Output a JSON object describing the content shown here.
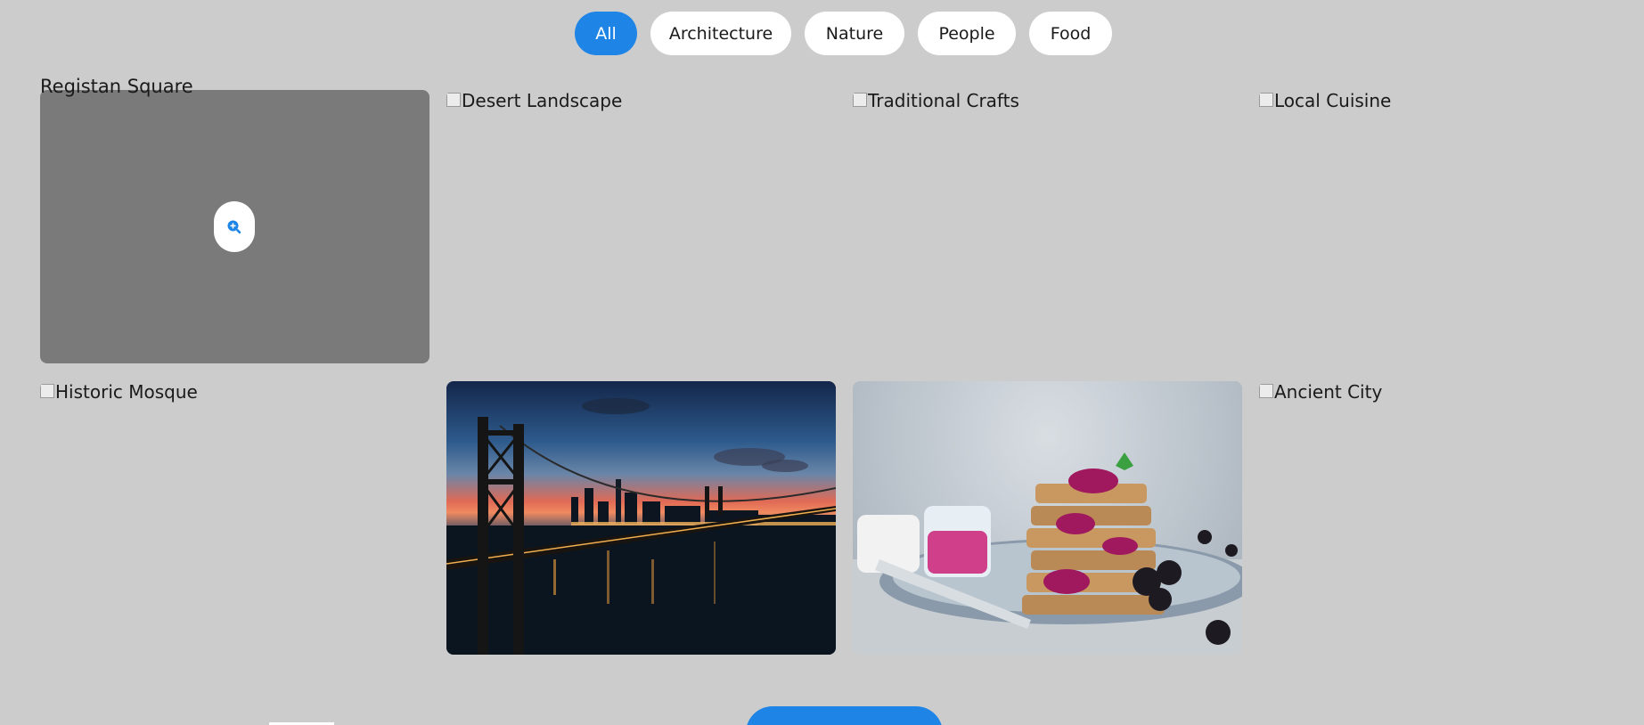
{
  "filters": [
    {
      "label": "All",
      "active": true
    },
    {
      "label": "Architecture",
      "active": false
    },
    {
      "label": "Nature",
      "active": false
    },
    {
      "label": "People",
      "active": false
    },
    {
      "label": "Food",
      "active": false
    }
  ],
  "gallery": {
    "items": [
      {
        "alt": "Registan Square",
        "state": "hovered"
      },
      {
        "alt": "Desert Landscape",
        "state": "broken"
      },
      {
        "alt": "Traditional Crafts",
        "state": "broken"
      },
      {
        "alt": "Local Cuisine",
        "state": "broken"
      },
      {
        "alt": "Historic Mosque",
        "state": "broken"
      },
      {
        "alt": "",
        "state": "photo",
        "subject": "city bridge at dusk"
      },
      {
        "alt": "",
        "state": "photo",
        "subject": "stack of waffles with berry jam"
      },
      {
        "alt": "Ancient City",
        "state": "broken"
      }
    ],
    "zoom_icon": "zoom-in-icon"
  },
  "colors": {
    "accent": "#1e84e6",
    "background": "#cccccc",
    "hover_overlay": "#7a7a7a"
  }
}
